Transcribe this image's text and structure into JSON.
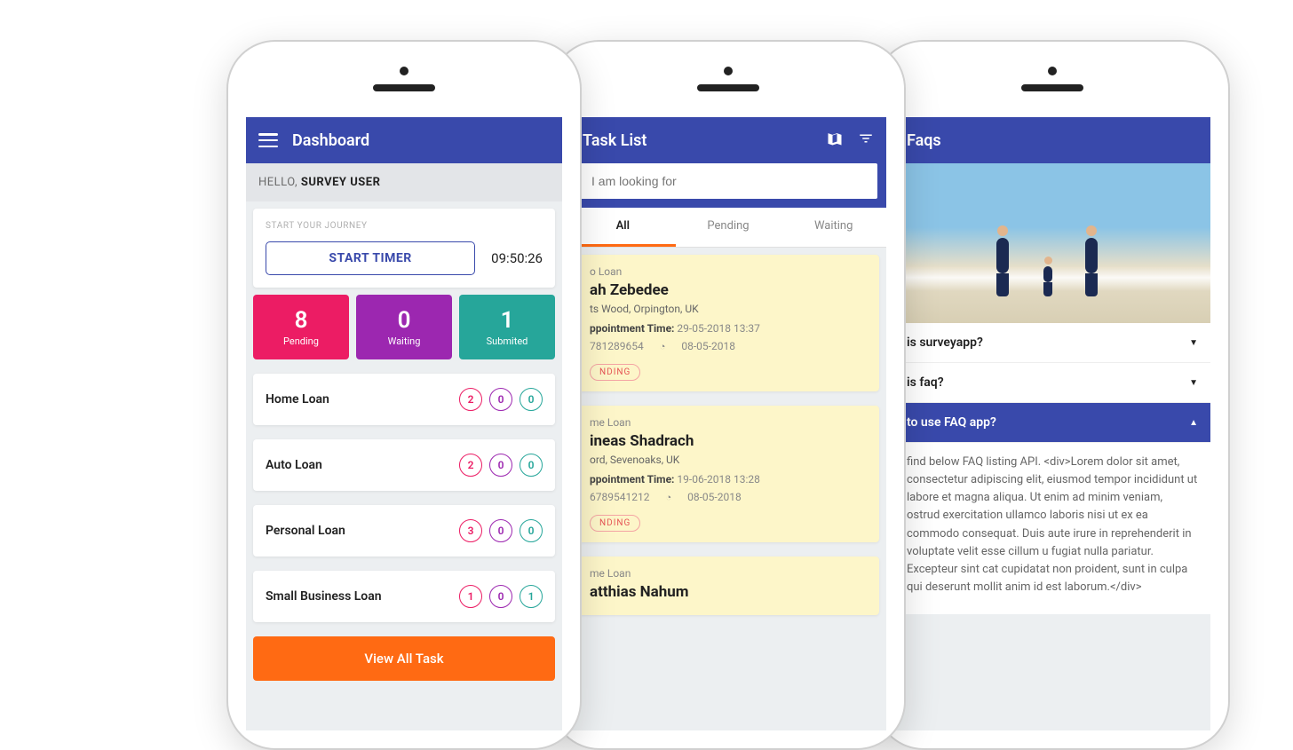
{
  "phone1": {
    "appbar_title": "Dashboard",
    "greeting_prefix": "HELLO, ",
    "greeting_name": "SURVEY USER",
    "journey_label": "START YOUR JOURNEY",
    "start_btn": "START TIMER",
    "timer": "09:50:26",
    "stats": [
      {
        "num": "8",
        "lbl": "Pending"
      },
      {
        "num": "0",
        "lbl": "Waiting"
      },
      {
        "num": "1",
        "lbl": "Submited"
      }
    ],
    "loans": [
      {
        "name": "Home Loan",
        "p": "2",
        "w": "0",
        "s": "0"
      },
      {
        "name": "Auto Loan",
        "p": "2",
        "w": "0",
        "s": "0"
      },
      {
        "name": "Personal Loan",
        "p": "3",
        "w": "0",
        "s": "0"
      },
      {
        "name": "Small Business Loan",
        "p": "1",
        "w": "0",
        "s": "1"
      }
    ],
    "view_all": "View All Task"
  },
  "phone2": {
    "appbar_title": "Task List",
    "search_placeholder": "I am looking for",
    "tabs": {
      "all": "All",
      "pending": "Pending",
      "waiting": "Waiting"
    },
    "tasks": [
      {
        "type": "o Loan",
        "name": "ah Zebedee",
        "location": "ts Wood, Orpington, UK",
        "appt_label": "ppointment Time:",
        "appt_value": "29-05-2018  13:37",
        "phone": "781289654",
        "date": "08-05-2018",
        "status": "NDING"
      },
      {
        "type": "me Loan",
        "name": "ineas Shadrach",
        "location": "ord, Sevenoaks, UK",
        "appt_label": "ppointment Time:",
        "appt_value": "19-06-2018  13:28",
        "phone": "6789541212",
        "date": "08-05-2018",
        "status": "NDING"
      },
      {
        "type": "me Loan",
        "name": "atthias Nahum"
      }
    ]
  },
  "phone3": {
    "appbar_title": "Faqs",
    "faqs": [
      {
        "q": "is surveyapp?",
        "open": false
      },
      {
        "q": "is faq?",
        "open": false
      },
      {
        "q": "to use FAQ app?",
        "open": true,
        "a": "find below FAQ listing API. <div>Lorem dolor sit amet, consectetur adipiscing elit, eiusmod tempor incididunt ut labore et magna aliqua. Ut enim ad minim veniam, ostrud exercitation ullamco laboris nisi ut ex ea commodo consequat. Duis aute irure in reprehenderit in voluptate velit esse cillum u fugiat nulla pariatur. Excepteur sint cat cupidatat non proident, sunt in culpa qui deserunt mollit anim id est laborum.</div>"
      }
    ]
  }
}
